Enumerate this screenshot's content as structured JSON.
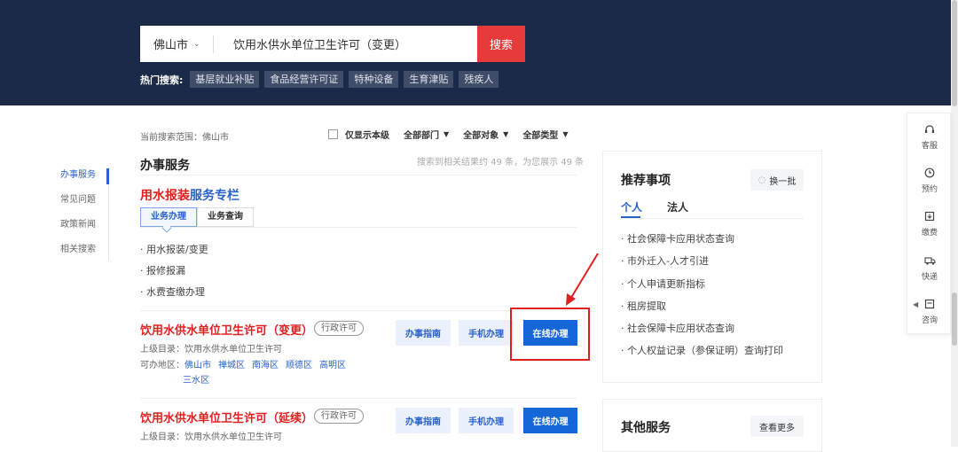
{
  "header": {
    "city": "佛山市",
    "query": "饮用水供水单位卫生许可（变更）",
    "search_button": "搜索",
    "hot_label": "热门搜索:",
    "hot_tags": [
      "基层就业补贴",
      "食品经营许可证",
      "特种设备",
      "生育津贴",
      "残疾人"
    ]
  },
  "filters": {
    "scope": "当前搜索范围：佛山市",
    "only_this_level": "仅显示本级",
    "department": "全部部门",
    "target": "全部对象",
    "type": "全部类型"
  },
  "left_nav": [
    "办事服务",
    "常见问题",
    "政策新闻",
    "相关搜索"
  ],
  "main": {
    "section_title": "办事服务",
    "result_count": "搜索到相关结果约 49 条，为您展示 49 条",
    "column": {
      "title_red": "用水报装",
      "title_blue": "服务专栏",
      "tabs": [
        "业务办理",
        "业务查询"
      ],
      "items": [
        "用水报装/变更",
        "报修报漏",
        "水费查缴办理"
      ]
    },
    "results": [
      {
        "title": "饮用水供水单位卫生许可（变更）",
        "badge": "行政许可",
        "parent": "上级目录：饮用水供水单位卫生许可",
        "region_label": "可办地区：",
        "regions": [
          "佛山市",
          "禅城区",
          "南海区",
          "顺德区",
          "高明区",
          "三水区"
        ],
        "btn_guide": "办事指南",
        "btn_mobile": "手机办理",
        "btn_online": "在线办理"
      },
      {
        "title": "饮用水供水单位卫生许可（延续）",
        "badge": "行政许可",
        "parent": "上级目录：饮用水供水单位卫生许可",
        "btn_guide": "办事指南",
        "btn_mobile": "手机办理",
        "btn_online": "在线办理"
      }
    ]
  },
  "recommend": {
    "title": "推荐事项",
    "refresh": "换一批",
    "tabs": [
      "个人",
      "法人"
    ],
    "items": [
      "社会保障卡应用状态查询",
      "市外迁入-人才引进",
      "个人申请更新指标",
      "租房提取",
      "社会保障卡应用状态查询",
      "个人权益记录（参保证明）查询打印"
    ]
  },
  "other": {
    "title": "其他服务",
    "more": "查看更多"
  },
  "float_bar": [
    {
      "label": "客服",
      "icon": "headset-icon"
    },
    {
      "label": "预约",
      "icon": "clock-icon"
    },
    {
      "label": "缴费",
      "icon": "payment-icon"
    },
    {
      "label": "快递",
      "icon": "truck-icon"
    },
    {
      "label": "咨询",
      "icon": "chat-icon"
    }
  ],
  "colors": {
    "header_bg": "#1b2a48",
    "accent_red": "#e02020",
    "accent_blue": "#2a62c9",
    "search_btn": "#e73b3b",
    "primary_btn": "#1566d6"
  }
}
